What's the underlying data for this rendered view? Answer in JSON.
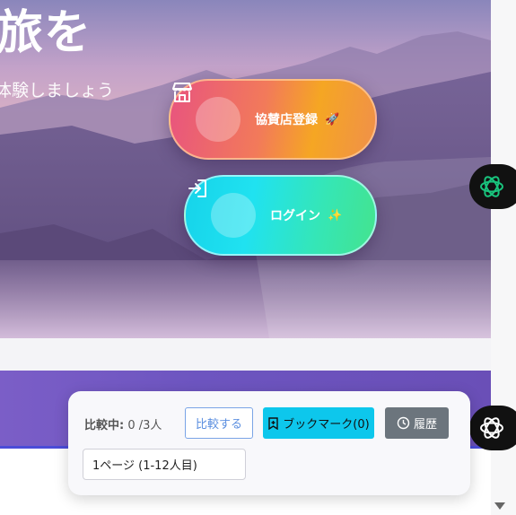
{
  "hero": {
    "title": "旅を",
    "subtitle": "体験しましょう",
    "register_label": "協賛店登録",
    "register_emoji": "🚀",
    "login_label": "ログイン",
    "login_emoji": "✨"
  },
  "compare": {
    "status_label": "比較中:",
    "status_count": "0 /3人",
    "compare_button": "比較する",
    "bookmark_button": "ブックマーク(0)",
    "history_button": "履歴",
    "page_select": "1ページ (1-12人目)"
  },
  "icons": {
    "register": "store-icon",
    "login": "login-icon",
    "bookmark": "bookmark-icon",
    "history": "clock-icon",
    "side_top": "openai-logo-icon",
    "side_bottom": "openai-logo-icon"
  },
  "colors": {
    "register_gradient": [
      "#e8547f",
      "#f5a623"
    ],
    "login_gradient": [
      "#16d3ea",
      "#44e38e"
    ],
    "bookmark_bg": "#0dc7ec",
    "history_bg": "#6c757d",
    "compare_border": "#7aa4e6",
    "band": "#6d55c0"
  }
}
